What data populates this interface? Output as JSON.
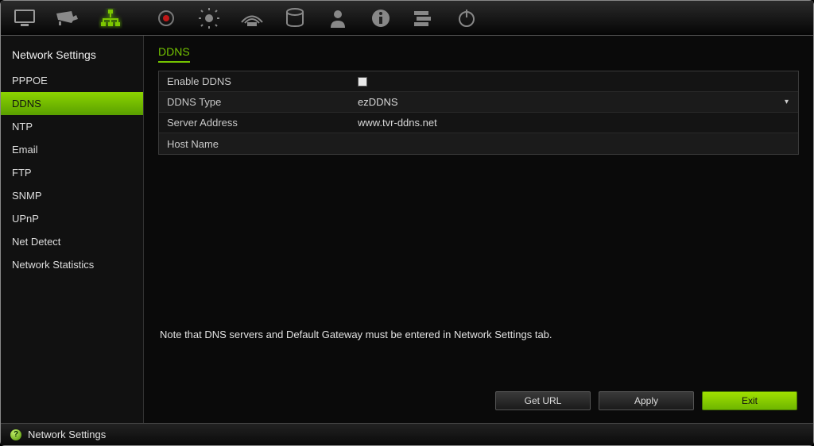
{
  "toolbar": {
    "icons": [
      {
        "name": "monitor-icon",
        "active": false
      },
      {
        "name": "camera-icon",
        "active": false
      },
      {
        "name": "network-icon",
        "active": true
      },
      {
        "name": "record-icon",
        "active": false
      },
      {
        "name": "alarm-icon",
        "active": false
      },
      {
        "name": "device-icon",
        "active": false
      },
      {
        "name": "hdd-icon",
        "active": false
      },
      {
        "name": "user-icon",
        "active": false
      },
      {
        "name": "info-icon",
        "active": false
      },
      {
        "name": "settings-icon",
        "active": false
      },
      {
        "name": "power-icon",
        "active": false
      }
    ]
  },
  "sidebar": {
    "header": "Network Settings",
    "items": [
      {
        "label": "PPPOE",
        "active": false
      },
      {
        "label": "DDNS",
        "active": true
      },
      {
        "label": "NTP",
        "active": false
      },
      {
        "label": "Email",
        "active": false
      },
      {
        "label": "FTP",
        "active": false
      },
      {
        "label": "SNMP",
        "active": false
      },
      {
        "label": "UPnP",
        "active": false
      },
      {
        "label": "Net Detect",
        "active": false
      },
      {
        "label": "Network Statistics",
        "active": false
      }
    ]
  },
  "page": {
    "title": "DDNS",
    "fields": {
      "enable_label": "Enable DDNS",
      "enable_checked": false,
      "ddns_type_label": "DDNS Type",
      "ddns_type_value": "ezDDNS",
      "server_address_label": "Server Address",
      "server_address_value": "www.tvr-ddns.net",
      "host_name_label": "Host Name",
      "host_name_value": ""
    },
    "note": "Note that DNS servers and Default Gateway must be entered in Network Settings tab.",
    "buttons": {
      "get_url": "Get URL",
      "apply": "Apply",
      "exit": "Exit"
    }
  },
  "statusbar": {
    "text": "Network Settings",
    "help_glyph": "?"
  }
}
